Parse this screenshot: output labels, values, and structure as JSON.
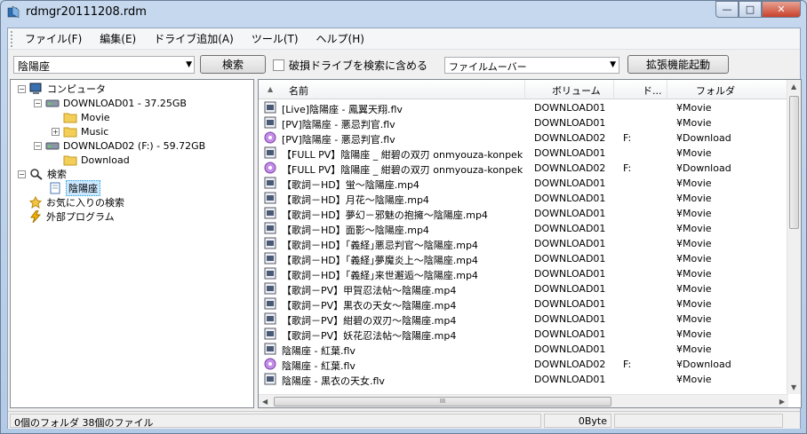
{
  "window": {
    "title": "rdmgr20111208.rdm",
    "min_label": "—",
    "max_label": "□",
    "close_label": "✕"
  },
  "menu": [
    "ファイル(F)",
    "編集(E)",
    "ドライブ追加(A)",
    "ツール(T)",
    "ヘルプ(H)"
  ],
  "toolbar": {
    "search_value": "陰陽座",
    "search_button": "検索",
    "include_broken_label": "破損ドライブを検索に含める",
    "include_broken_checked": false,
    "mover_select_value": "ファイルムーバー",
    "extension_button": "拡張機能起動"
  },
  "tree": {
    "computer": "コンピュータ",
    "drive1": "DOWNLOAD01 - 37.25GB",
    "drive1_folders": [
      "Movie",
      "Music"
    ],
    "drive2": "DOWNLOAD02 (F:) - 59.72GB",
    "drive2_folders": [
      "Download"
    ],
    "search": "検索",
    "search_item": "陰陽座",
    "favorites": "お気に入りの検索",
    "external": "外部プログラム"
  },
  "list": {
    "headers": [
      "名前",
      "ボリューム",
      "ド...",
      "フォルダ"
    ],
    "rows": [
      {
        "name": "[Live]陰陽座 - 鳳翼天翔.flv",
        "volume": "DOWNLOAD01",
        "drive": "",
        "folder": "¥Movie",
        "icon": "flv"
      },
      {
        "name": "[PV]陰陽座 - 悪忌判官.flv",
        "volume": "DOWNLOAD01",
        "drive": "",
        "folder": "¥Movie",
        "icon": "flv"
      },
      {
        "name": "[PV]陰陽座 - 悪忌判官.flv",
        "volume": "DOWNLOAD02",
        "drive": "F:",
        "folder": "¥Download",
        "icon": "media"
      },
      {
        "name": "【FULL PV】陰陽座 _ 紺碧の双刃  onmyouza-konpeki...",
        "volume": "DOWNLOAD01",
        "drive": "",
        "folder": "¥Movie",
        "icon": "flv"
      },
      {
        "name": "【FULL PV】陰陽座 _ 紺碧の双刃  onmyouza-konpeki...",
        "volume": "DOWNLOAD02",
        "drive": "F:",
        "folder": "¥Download",
        "icon": "media"
      },
      {
        "name": "【歌詞－HD】蛍～陰陽座.mp4",
        "volume": "DOWNLOAD01",
        "drive": "",
        "folder": "¥Movie",
        "icon": "flv"
      },
      {
        "name": "【歌詞－HD】月花～陰陽座.mp4",
        "volume": "DOWNLOAD01",
        "drive": "",
        "folder": "¥Movie",
        "icon": "flv"
      },
      {
        "name": "【歌詞－HD】夢幻－邪魅の抱擁～陰陽座.mp4",
        "volume": "DOWNLOAD01",
        "drive": "",
        "folder": "¥Movie",
        "icon": "flv"
      },
      {
        "name": "【歌詞－HD】面影～陰陽座.mp4",
        "volume": "DOWNLOAD01",
        "drive": "",
        "folder": "¥Movie",
        "icon": "flv"
      },
      {
        "name": "【歌詞－HD】｢義経｣悪忌判官～陰陽座.mp4",
        "volume": "DOWNLOAD01",
        "drive": "",
        "folder": "¥Movie",
        "icon": "flv"
      },
      {
        "name": "【歌詞－HD】｢義経｣夢魔炎上～陰陽座.mp4",
        "volume": "DOWNLOAD01",
        "drive": "",
        "folder": "¥Movie",
        "icon": "flv"
      },
      {
        "name": "【歌詞－HD】｢義経｣来世邂逅～陰陽座.mp4",
        "volume": "DOWNLOAD01",
        "drive": "",
        "folder": "¥Movie",
        "icon": "flv"
      },
      {
        "name": "【歌詞－PV】甲賀忍法帖～陰陽座.mp4",
        "volume": "DOWNLOAD01",
        "drive": "",
        "folder": "¥Movie",
        "icon": "flv"
      },
      {
        "name": "【歌詞－PV】黒衣の天女～陰陽座.mp4",
        "volume": "DOWNLOAD01",
        "drive": "",
        "folder": "¥Movie",
        "icon": "flv"
      },
      {
        "name": "【歌詞－PV】紺碧の双刃～陰陽座.mp4",
        "volume": "DOWNLOAD01",
        "drive": "",
        "folder": "¥Movie",
        "icon": "flv"
      },
      {
        "name": "【歌詞－PV】妖花忍法帖～陰陽座.mp4",
        "volume": "DOWNLOAD01",
        "drive": "",
        "folder": "¥Movie",
        "icon": "flv"
      },
      {
        "name": "陰陽座 - 紅葉.flv",
        "volume": "DOWNLOAD01",
        "drive": "",
        "folder": "¥Movie",
        "icon": "flv"
      },
      {
        "name": "陰陽座 - 紅葉.flv",
        "volume": "DOWNLOAD02",
        "drive": "F:",
        "folder": "¥Download",
        "icon": "media"
      },
      {
        "name": "陰陽座 - 黒衣の天女.flv",
        "volume": "DOWNLOAD01",
        "drive": "",
        "folder": "¥Movie",
        "icon": "flv"
      }
    ],
    "hscroll_grip": "III"
  },
  "status": {
    "counts": "0個のフォルダ 38個のファイル",
    "size": "0Byte"
  },
  "colors": {
    "selection": "#cce8ff",
    "folder": "#f3cf5a",
    "drive": "#7f8fa3"
  }
}
